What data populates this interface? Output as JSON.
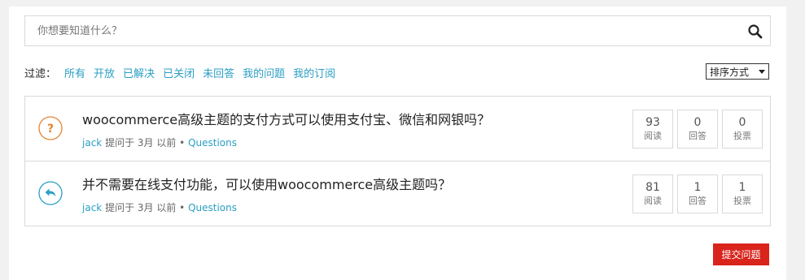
{
  "search": {
    "placeholder": "你想要知道什么？"
  },
  "filter": {
    "label": "过滤：",
    "items": [
      "所有",
      "开放",
      "已解决",
      "已关闭",
      "未回答",
      "我的问题",
      "我的订阅"
    ]
  },
  "sort": {
    "label": "排序方式"
  },
  "questions": [
    {
      "icon": "question-icon",
      "title": "woocommerce高级主题的支付方式可以使用支付宝、微信和网银吗？",
      "author": "jack",
      "asked": "提问于 3月 以前",
      "category": "Questions",
      "views": "93",
      "views_label": "阅读",
      "answers": "0",
      "answers_label": "回答",
      "votes": "0",
      "votes_label": "投票"
    },
    {
      "icon": "reply-icon",
      "title": "并不需要在线支付功能，可以使用woocommerce高级主题吗？",
      "author": "jack",
      "asked": "提问于 3月 以前",
      "category": "Questions",
      "views": "81",
      "views_label": "阅读",
      "answers": "1",
      "answers_label": "回答",
      "votes": "1",
      "votes_label": "投票"
    }
  ],
  "ask_button": "提交问题",
  "colors": {
    "link": "#2a9fc4",
    "open_icon": "#e08530",
    "answered_icon": "#2a9fc4",
    "ask_button": "#d9241c"
  }
}
